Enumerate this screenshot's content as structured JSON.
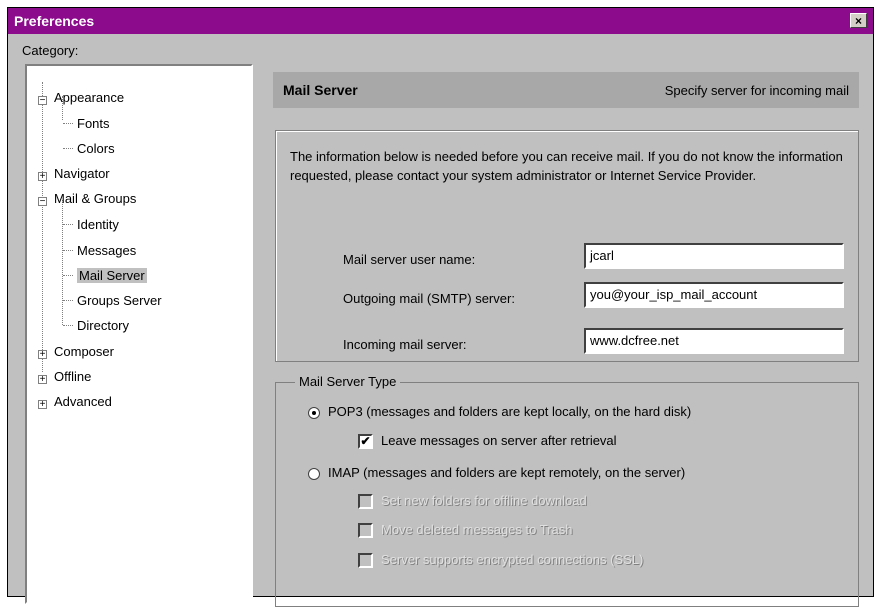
{
  "window": {
    "title": "Preferences",
    "close_symbol": "×"
  },
  "category_label": "Category:",
  "tree": {
    "appearance": "Appearance",
    "fonts": "Fonts",
    "colors": "Colors",
    "navigator": "Navigator",
    "mail_groups": "Mail & Groups",
    "identity": "Identity",
    "messages": "Messages",
    "mail_server": "Mail Server",
    "groups_server": "Groups Server",
    "directory": "Directory",
    "composer": "Composer",
    "offline": "Offline",
    "advanced": "Advanced",
    "expand_symbol": "+",
    "collapse_symbol": "−"
  },
  "panel": {
    "title": "Mail Server",
    "description": "Specify server for incoming mail",
    "info_text": "The information below is needed before you can receive mail. If you do not know the information requested, please contact your system administrator or Internet Service Provider.",
    "fields": {
      "user_label": "Mail server user name:",
      "user_value": "jcarl",
      "smtp_label": "Outgoing mail (SMTP) server:",
      "smtp_value": "you@your_isp_mail_account",
      "incoming_label": "Incoming mail server:",
      "incoming_value": "www.dcfree.net"
    },
    "server_type": {
      "legend": "Mail Server Type",
      "pop3": "POP3 (messages and folders are kept locally, on the hard disk)",
      "pop3_selected": true,
      "leave_on_server": "Leave messages on server after retrieval",
      "leave_on_server_checked": true,
      "imap": "IMAP (messages and folders are kept remotely, on the server)",
      "imap_selected": false,
      "imap_opt1": "Set new folders for offline download",
      "imap_opt2": "Move deleted messages to Trash",
      "imap_opt3": "Server supports encrypted connections (SSL)",
      "check_mark": "✔"
    }
  }
}
